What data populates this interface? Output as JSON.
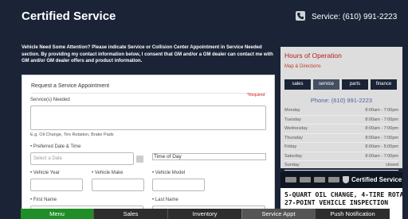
{
  "header": {
    "title": "Certified Service",
    "phone_label": "Service: (610) 991-2223"
  },
  "notice": {
    "text": "Vehicle Need Some Attention? Please indicate Service or Collision  Center Appointment in Service Needed section. By providing my contact information below, I consent that GM and/or a GM dealer can contact me with GM and/or GM dealer offers and product information."
  },
  "form": {
    "heading": "Request a Service Appointment",
    "required_note": "*Required",
    "service_label": "Service(s) Needed",
    "service_hint": "E.g. Oil Change, Tire Rotation, Brake Pads",
    "date_label": "• Preferred Date & Time",
    "date_placeholder": "Select a Date",
    "time_value": "Time of Day",
    "year_label": "• Vehicle Year",
    "make_label": "• Vehicle Make",
    "model_label": "• Vehicle Model",
    "first_name_label": "• First Name",
    "last_name_label": "• Last Name"
  },
  "sidebar": {
    "title": "Hours of Operation",
    "map_link": "Map & Directions",
    "tabs": [
      "sales",
      "service",
      "parts",
      "finance"
    ],
    "active_tab": "service",
    "phone": "Phone: (610) 991-2223",
    "hours": [
      {
        "day": "Monday",
        "time": "8:00am - 7:00pm"
      },
      {
        "day": "Tuesday",
        "time": "8:00am - 7:00pm"
      },
      {
        "day": "Wednesday",
        "time": "8:00am - 7:00pm"
      },
      {
        "day": "Thursday",
        "time": "8:00am - 7:00pm"
      },
      {
        "day": "Friday",
        "time": "8:00am - 5:00pm"
      },
      {
        "day": "Saturday",
        "time": "8:00am - 7:00pm"
      },
      {
        "day": "Sunday",
        "time": "closed"
      }
    ]
  },
  "ad": {
    "brand": "Certified Service",
    "line1": "5-QUART OIL CHANGE, 4-TIRE ROTATION,",
    "line2": "27-POINT VEHICLE INSPECTION"
  },
  "bottom_nav": {
    "menu": "Menu",
    "sales": "Sales",
    "inventory": "Inventory",
    "service_appt": "Service Appt",
    "push": "Push Notification"
  },
  "colors": {
    "frame": "#1b2437",
    "accent_red": "#b21f1f",
    "menu_green": "#1f8e26"
  }
}
